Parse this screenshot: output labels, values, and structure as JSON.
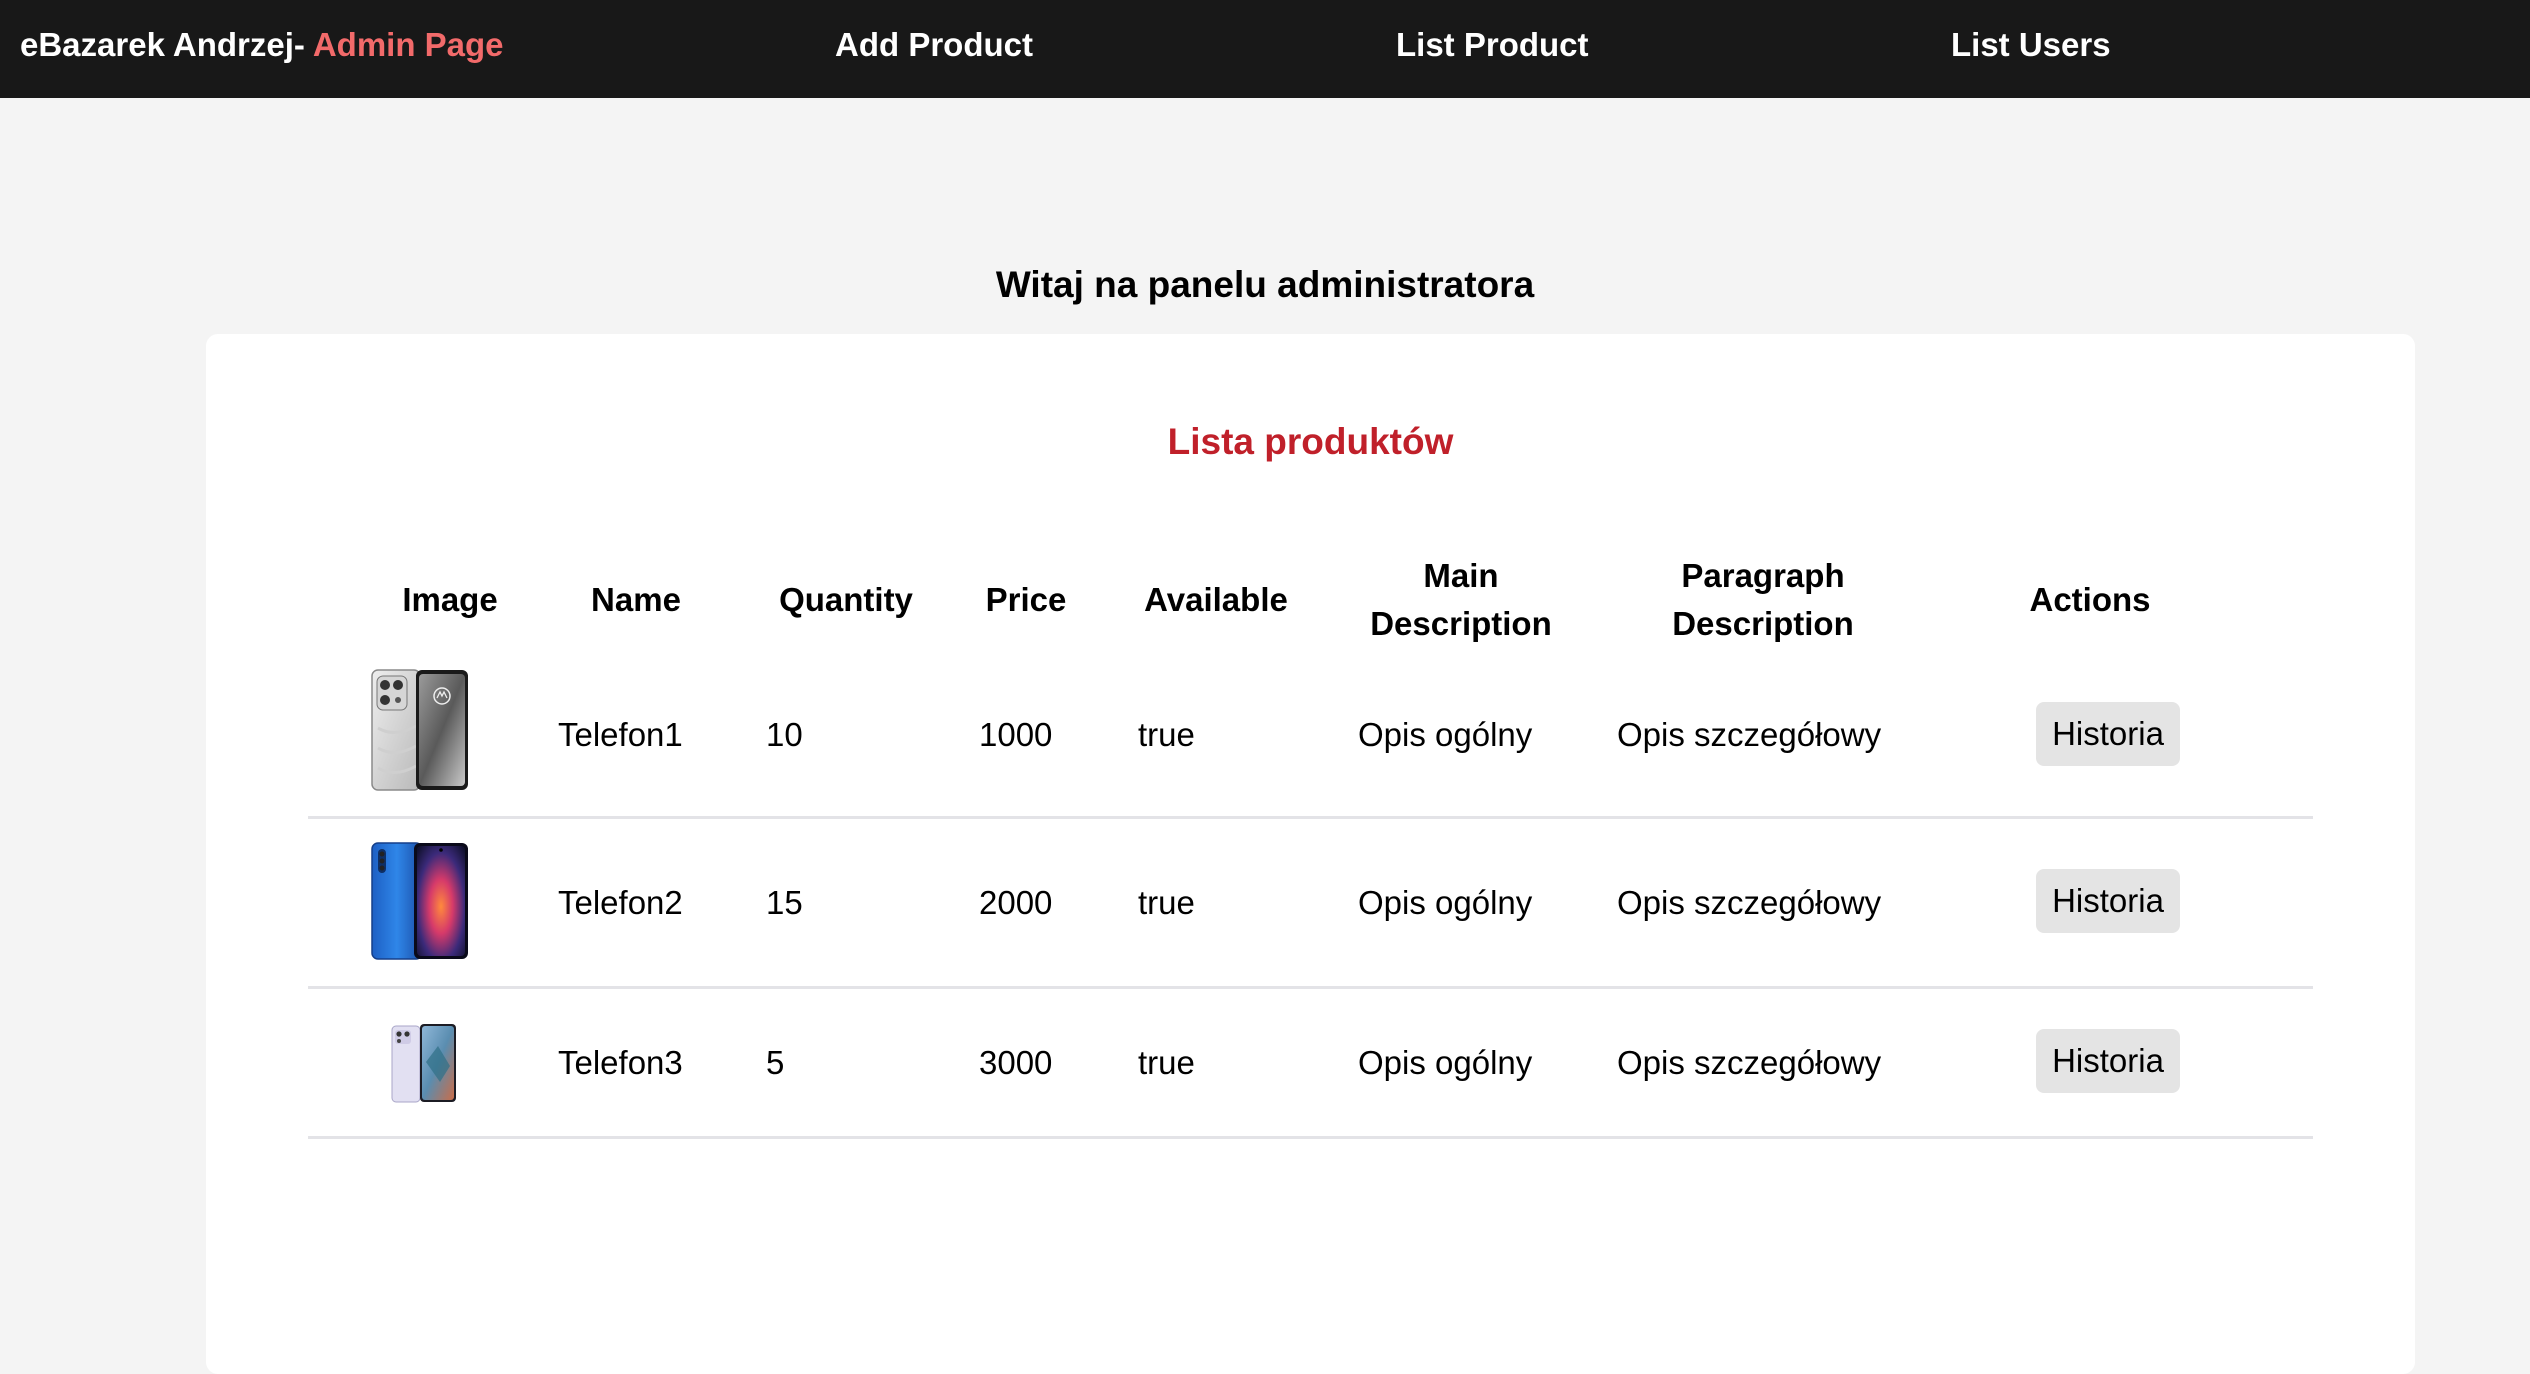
{
  "navbar": {
    "brand_prefix": "eBazarek Andrzej-",
    "brand_accent": " Admin Page",
    "links": [
      "Add Product",
      "List Product",
      "List Users"
    ]
  },
  "welcome": "Witaj na panelu administratora",
  "table": {
    "title": "Lista produktów",
    "headers": {
      "image": "Image",
      "name": "Name",
      "quantity": "Quantity",
      "price": "Price",
      "available": "Available",
      "main_desc_1": "Main",
      "main_desc_2": "Description",
      "par_desc_1": "Paragraph",
      "par_desc_2": "Description",
      "actions": "Actions"
    },
    "rows": [
      {
        "image": "phone-silver",
        "name": "Telefon1",
        "quantity": "10",
        "price": "1000",
        "available": "true",
        "main_description": "Opis ogólny",
        "paragraph_description": "Opis szczegółowy",
        "action": "Historia"
      },
      {
        "image": "phone-blue",
        "name": "Telefon2",
        "quantity": "15",
        "price": "2000",
        "available": "true",
        "main_description": "Opis ogólny",
        "paragraph_description": "Opis szczegółowy",
        "action": "Historia"
      },
      {
        "image": "phone-lilac",
        "name": "Telefon3",
        "quantity": "5",
        "price": "3000",
        "available": "true",
        "main_description": "Opis ogólny",
        "paragraph_description": "Opis szczegółowy",
        "action": "Historia"
      }
    ]
  },
  "colors": {
    "navbar_bg": "#181818",
    "brand_accent": "#f26a6a",
    "title_red": "#c0202a",
    "page_bg": "#f4f4f4",
    "button_bg": "#e4e4e4"
  }
}
